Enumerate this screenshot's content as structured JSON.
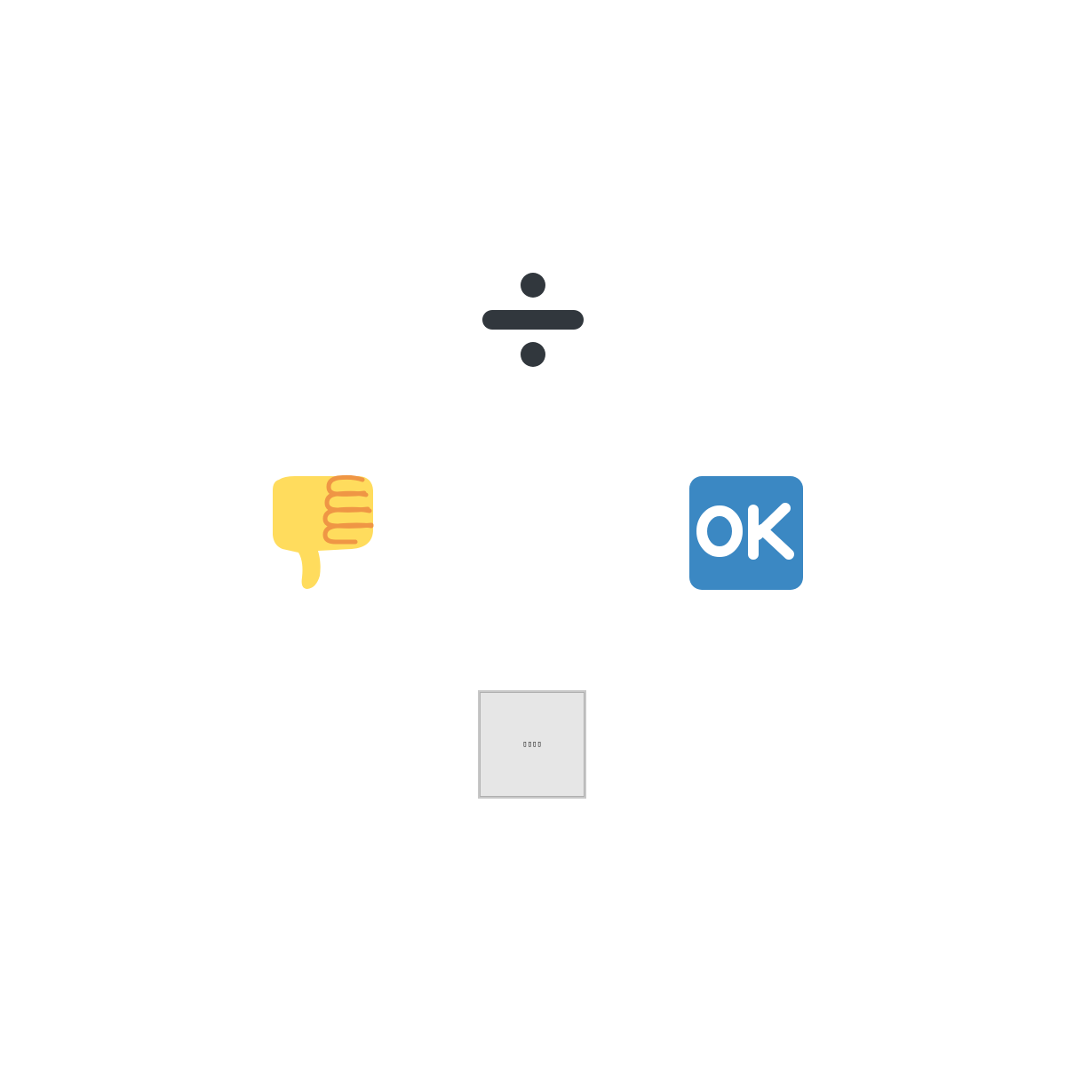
{
  "icons": [
    {
      "name": "divide-icon",
      "color": "#31373d"
    },
    {
      "name": "thumbs-down-icon",
      "colors": {
        "skin": "#ffdc5d",
        "outline": "#ef9645"
      }
    },
    {
      "name": "ok-button-icon",
      "colors": {
        "background": "#3b88c3",
        "text": "#ffffff"
      },
      "label": "OK"
    },
    {
      "name": "missing-glyph-icon",
      "colors": {
        "background": "#e6e6e6",
        "border": "#c8c8c8"
      },
      "text": "▯▯▯▯"
    }
  ]
}
